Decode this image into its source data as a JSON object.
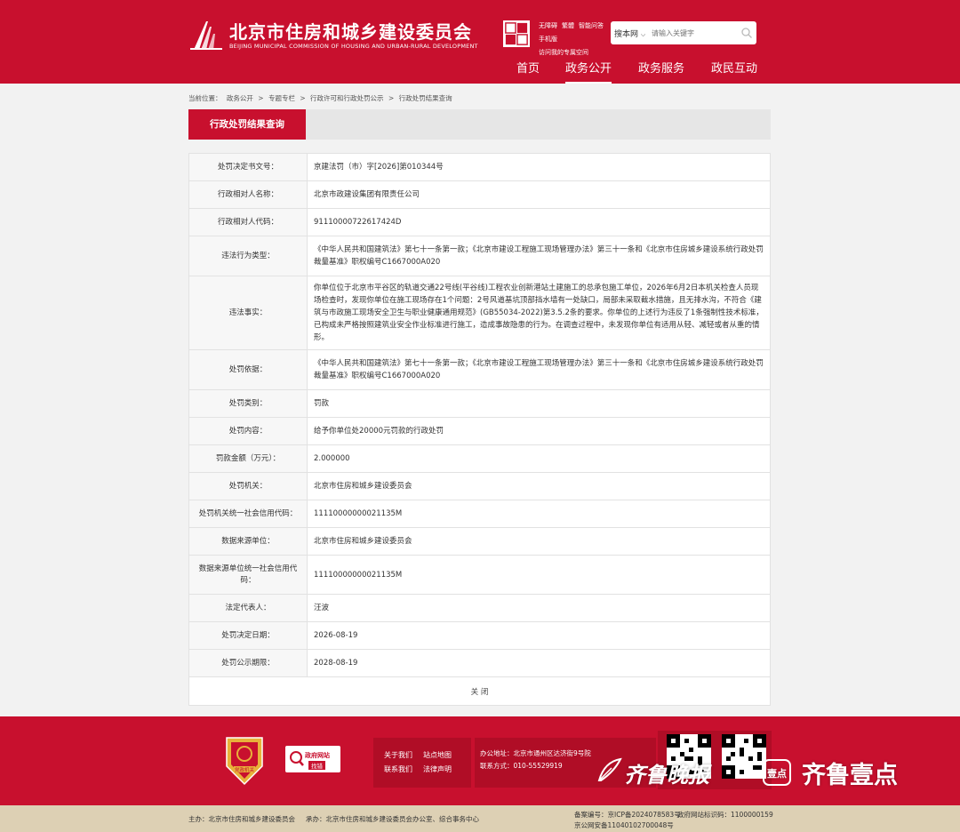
{
  "header": {
    "site_title": "北京市住房和城乡建设委员会",
    "site_subtitle": "BEIJING MUNICIPAL COMMISSION OF HOUSING AND URBAN-RURAL DEVELOPMENT",
    "top_links": [
      "无障碍",
      "繁體",
      "智能问答",
      "手机版",
      "访问我的专属空间"
    ],
    "search": {
      "scope": "搜本网",
      "placeholder": "请输入关键字"
    },
    "nav": [
      "首页",
      "政务公开",
      "政务服务",
      "政民互动"
    ],
    "nav_active": "政务公开",
    "accent_color": "#c8102e"
  },
  "breadcrumb": {
    "prefix": "当前位置：",
    "items": [
      "政务公开",
      "专题专栏",
      "行政许可和行政处罚公示",
      "行政处罚结果查询"
    ],
    "separator": ">"
  },
  "section_title": "行政处罚结果查询",
  "record": [
    {
      "label": "处罚决定书文号：",
      "value": "京建法罚（市）字[2026]第010344号"
    },
    {
      "label": "行政相对人名称：",
      "value": "北京市政建设集团有限责任公司"
    },
    {
      "label": "行政相对人代码：",
      "value": "91110000722617424D"
    },
    {
      "label": "违法行为类型：",
      "value": "《中华人民共和国建筑法》第七十一条第一款；《北京市建设工程施工现场管理办法》第三十一条和《北京市住房城乡建设系统行政处罚裁量基准》职权编号C1667000A020"
    },
    {
      "label": "违法事实：",
      "value": "你单位位于北京市平谷区的轨道交通22号线(平谷线)工程农业创新港站土建施工的总承包施工单位，2026年6月2日本机关检查人员现场检查时，发现你单位在施工现场存在1个问题：2号风道基坑顶部挡水墙有一处缺口，局部未采取截水措施，且无排水沟，不符合《建筑与市政施工现场安全卫生与职业健康通用规范》(GB55034-2022)第3.5.2条的要求。你单位的上述行为违反了1条强制性技术标准，已构成未严格按照建筑业安全作业标准进行施工，造成事故隐患的行为。在调查过程中，未发现你单位有适用从轻、减轻或者从重的情形。"
    },
    {
      "label": "处罚依据：",
      "value": "《中华人民共和国建筑法》第七十一条第一款；《北京市建设工程施工现场管理办法》第三十一条和《北京市住房城乡建设系统行政处罚裁量基准》职权编号C1667000A020"
    },
    {
      "label": "处罚类别：",
      "value": "罚款"
    },
    {
      "label": "处罚内容：",
      "value": "给予你单位处20000元罚款的行政处罚"
    },
    {
      "label": "罚款金额（万元）：",
      "value": "2.000000"
    },
    {
      "label": "处罚机关：",
      "value": "北京市住房和城乡建设委员会"
    },
    {
      "label": "处罚机关统一社会信用代码：",
      "value": "11110000000021135M"
    },
    {
      "label": "数据来源单位：",
      "value": "北京市住房和城乡建设委员会"
    },
    {
      "label": "数据来源单位统一社会信用代码：",
      "value": "11110000000021135M"
    },
    {
      "label": "法定代表人：",
      "value": "汪波"
    },
    {
      "label": "处罚决定日期：",
      "value": "2026-08-19"
    },
    {
      "label": "处罚公示期限：",
      "value": "2028-08-19"
    }
  ],
  "close_label": "关 闭",
  "footer": {
    "party_badge_text": "党政机关",
    "gov_site_text": "政府网站",
    "gov_site_sub": "找错",
    "links": [
      "关于我们",
      "站点地图",
      "联系我们",
      "法律声明"
    ],
    "address": "办公地址：北京市通州区达济街9号院",
    "phone": "联系方式：010-55529919",
    "sponsor": "主办：北京市住房和城乡建设委员会",
    "organizer": "承办：北京市住房和城乡建设委员会办公室、综合事务中心",
    "icp": "备案编号：京ICP备2024078583号",
    "gov_id": "政府网站标识码：1100000159",
    "police": "京公网安备11040102700048号",
    "bottom_color": "#ddd0b4"
  },
  "watermark": {
    "brand_cn": "齐鲁晚报",
    "badge": "壹点",
    "brand_app": "齐鲁壹点"
  }
}
